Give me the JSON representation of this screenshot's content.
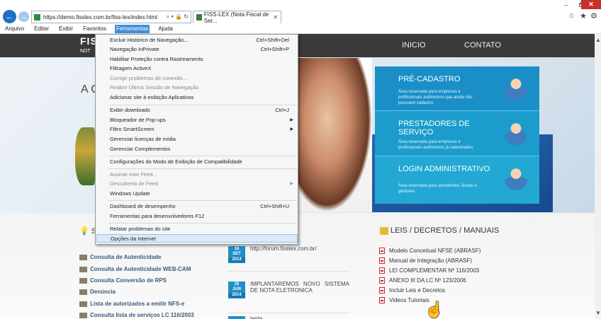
{
  "browser": {
    "url": "https://demo.fisslex.com.br/fiss-lex/index.html",
    "tab_title": "FISS-LEX (Nota Fiscal de Ser...",
    "address_controls": "⌕ ▾ 🔒 ↻",
    "tab_close": "✕",
    "window_controls": {
      "minimize": "–",
      "maximize": "🗗",
      "close": "✕"
    },
    "toolbar_icons": [
      "home-icon",
      "star-icon",
      "gear-icon"
    ],
    "toolbar_glyphs": [
      "⌂",
      "★",
      "⚙"
    ]
  },
  "menubar": [
    "Arquivo",
    "Editar",
    "Exibir",
    "Favoritos",
    "Ferramentas",
    "Ajuda"
  ],
  "menubar_active": 4,
  "tools_menu": [
    {
      "label": "Excluir Histórico de Navegação...",
      "shortcut": "Ctrl+Shift+Del"
    },
    {
      "label": "Navegação InPrivate",
      "shortcut": "Ctrl+Shift+P"
    },
    {
      "label": "Habilitar Proteção contra Rastreamento",
      "shortcut": ""
    },
    {
      "label": "Filtragem ActiveX",
      "shortcut": ""
    },
    {
      "label": "Corrigir problemas de conexão...",
      "shortcut": "",
      "disabled": true
    },
    {
      "label": "Reabrir Última Sessão de Navegação",
      "shortcut": "",
      "disabled": true
    },
    {
      "label": "Adicionar site à exibição Aplicativos",
      "shortcut": ""
    },
    {
      "label": "Exibir downloads",
      "shortcut": "Ctrl+J"
    },
    {
      "label": "Bloqueador de Pop-ups",
      "shortcut": "",
      "submenu": true
    },
    {
      "label": "Filtro SmartScreen",
      "shortcut": "",
      "submenu": true
    },
    {
      "label": "Gerenciar licenças de mídia",
      "shortcut": ""
    },
    {
      "label": "Gerenciar Complementos",
      "shortcut": ""
    },
    {
      "label": "Configurações do Modo de Exibição de Compatibilidade",
      "shortcut": ""
    },
    {
      "label": "Assinar este Feed...",
      "shortcut": "",
      "disabled": true
    },
    {
      "label": "Descoberta de Feed",
      "shortcut": "",
      "disabled": true,
      "submenu": true
    },
    {
      "label": "Windows Update",
      "shortcut": ""
    },
    {
      "label": "Dashboard de desempenho",
      "shortcut": "Ctrl+Shift+U"
    },
    {
      "label": "Ferramentas para desenvolvedores F12",
      "shortcut": ""
    },
    {
      "label": "Relatar problemas do site",
      "shortcut": ""
    },
    {
      "label": "Opções da Internet",
      "shortcut": "",
      "highlighted": true
    }
  ],
  "site": {
    "logo": "FISS",
    "logo_sub": "NOT",
    "nav": [
      "INICIO",
      "CONTATO"
    ],
    "hero_title": "A C",
    "cards": [
      {
        "title": "PRÉ-CADASTRO",
        "desc": "Área reservada para empresas e profissionais autônomos que ainda não possuem cadastro"
      },
      {
        "title": "PRESTADORES DE SERVIÇO",
        "desc": "Área reservada para empresas e profissionais autônomos já cadastrados"
      },
      {
        "title": "LOGIN ADMINISTRATIVO",
        "desc": "Área reservada para atendentes, fiscais e gestores"
      }
    ],
    "services_title": "S",
    "services": [
      "Consulta de Autenticidade",
      "Consulta de Autenticidade WEB-CAM",
      "Consulta Conversão de RPS",
      "Denúncia",
      "Lista de autorizados a emitir NFS-e",
      "Consulta lista de serviços LC 116/2003"
    ],
    "news": [
      {
        "day": "18",
        "month": "SET",
        "year": "2014",
        "text": "http://forum.fisslex.com.br/"
      },
      {
        "day": "26",
        "month": "JUN",
        "year": "2014",
        "text": "IMPLANTAREMOS NOVO SISTEMA DE NOTA ELETRONICA"
      },
      {
        "day": "",
        "month": "",
        "year": "",
        "text": "teste"
      }
    ],
    "laws_title": "LEIS / DECRETOS / MANUAIS",
    "laws": [
      "Modelo Conceitual NFSE (ABRASF)",
      "Manual de Integração (ABRASF)",
      "LEI COMPLEMENTAR Nº 116/2003",
      "ANEXO III DA LC Nº 123/2006",
      "Incluir Leis e Decretos",
      "Videos Tutoriais"
    ]
  }
}
